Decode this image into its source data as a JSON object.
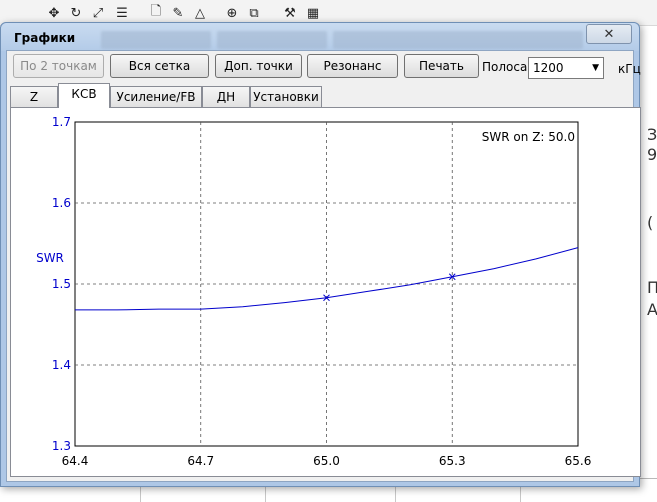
{
  "dialog": {
    "title": "Графики"
  },
  "buttons": [
    {
      "label": "По 2 точкам",
      "enabled": false
    },
    {
      "label": "Вся сетка",
      "enabled": true
    },
    {
      "label": "Доп. точки",
      "enabled": true
    },
    {
      "label": "Резонанс",
      "enabled": true
    },
    {
      "label": "Печать",
      "enabled": true
    }
  ],
  "bandwidth": {
    "label": "Полоса",
    "value": "1200",
    "unit": "кГц"
  },
  "tabs": [
    {
      "label": "Z",
      "active": false
    },
    {
      "label": "КСВ",
      "active": true
    },
    {
      "label": "Усиление/FB",
      "active": false
    },
    {
      "label": "ДН",
      "active": false
    },
    {
      "label": "Установки",
      "active": false
    }
  ],
  "chart_data": {
    "type": "line",
    "annotation": "SWR on Z: 50.0",
    "ylabel": "SWR",
    "xlabel": "",
    "xlim": [
      64.4,
      65.6
    ],
    "ylim": [
      1.3,
      1.7
    ],
    "x_ticks": [
      "64.4",
      "64.7",
      "65.0",
      "65.3",
      "65.6"
    ],
    "y_ticks": [
      "1.3",
      "1.4",
      "1.5",
      "1.6",
      "1.7"
    ],
    "grid": true,
    "line_color": "#0000cc",
    "series": [
      {
        "x": [
          64.4,
          64.5,
          64.6,
          64.7,
          64.8,
          64.9,
          65.0,
          65.1,
          65.2,
          65.3,
          65.4,
          65.5,
          65.6
        ],
        "values": [
          1.468,
          1.468,
          1.469,
          1.469,
          1.472,
          1.477,
          1.483,
          1.491,
          1.499,
          1.509,
          1.519,
          1.531,
          1.545
        ]
      }
    ],
    "markers": [
      {
        "x": 65.0,
        "y": 1.483
      },
      {
        "x": 65.3,
        "y": 1.509
      }
    ]
  }
}
